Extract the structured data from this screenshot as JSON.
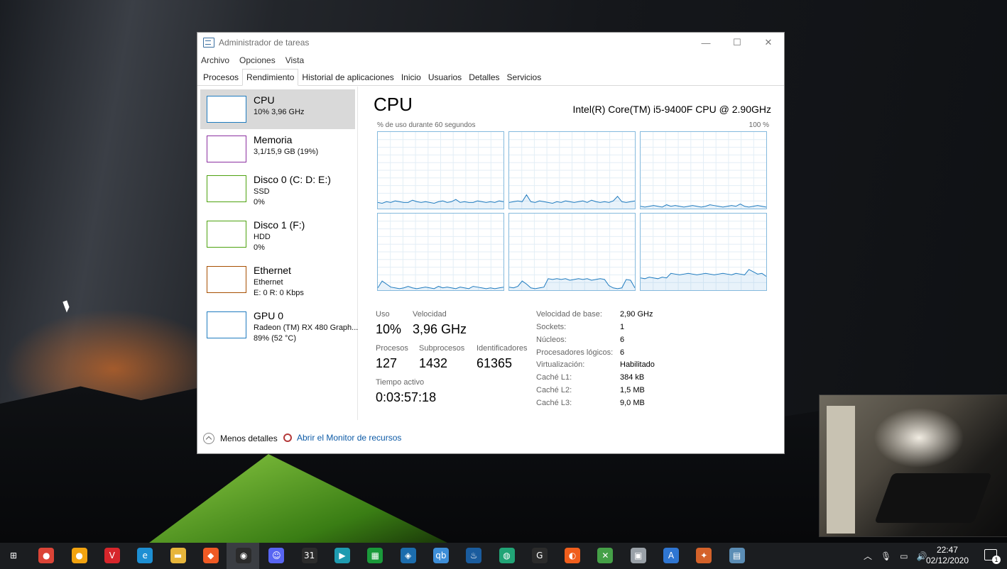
{
  "window": {
    "title": "Administrador de tareas",
    "controls": {
      "minimize": "—",
      "maximize": "☐",
      "close": "✕"
    }
  },
  "menu": [
    "Archivo",
    "Opciones",
    "Vista"
  ],
  "tabs": [
    "Procesos",
    "Rendimiento",
    "Historial de aplicaciones",
    "Inicio",
    "Usuarios",
    "Detalles",
    "Servicios"
  ],
  "active_tab": "Rendimiento",
  "sidebar": [
    {
      "name": "CPU",
      "line1": "10% 3,96 GHz",
      "line2": "",
      "color": "#1f7bbf",
      "selected": true
    },
    {
      "name": "Memoria",
      "line1": "3,1/15,9 GB (19%)",
      "line2": "",
      "color": "#8b2fa0",
      "selected": false
    },
    {
      "name": "Disco 0 (C: D: E:)",
      "line1": "SSD",
      "line2": "0%",
      "color": "#4da20f",
      "selected": false
    },
    {
      "name": "Disco 1 (F:)",
      "line1": "HDD",
      "line2": "0%",
      "color": "#4da20f",
      "selected": false
    },
    {
      "name": "Ethernet",
      "line1": "Ethernet",
      "line2": "E: 0 R: 0 Kbps",
      "color": "#a74f01",
      "selected": false
    },
    {
      "name": "GPU 0",
      "line1": "Radeon (TM) RX 480 Graph...",
      "line2": "89% (52 °C)",
      "color": "#1f7bbf",
      "selected": false
    }
  ],
  "main": {
    "title": "CPU",
    "model": "Intel(R) Core(TM) i5-9400F CPU @ 2.90GHz",
    "usage_label": "% de uso durante 60 segundos",
    "max_label": "100 %",
    "stats": {
      "uso_label": "Uso",
      "uso": "10%",
      "velocidad_label": "Velocidad",
      "velocidad": "3,96 GHz",
      "procesos_label": "Procesos",
      "procesos": "127",
      "subprocesos_label": "Subprocesos",
      "subprocesos": "1432",
      "identificadores_label": "Identificadores",
      "identificadores": "61365",
      "tiempo_label": "Tiempo activo",
      "tiempo": "0:03:57:18"
    },
    "details": [
      {
        "k": "Velocidad de base:",
        "v": "2,90 GHz"
      },
      {
        "k": "Sockets:",
        "v": "1"
      },
      {
        "k": "Núcleos:",
        "v": "6"
      },
      {
        "k": "Procesadores lógicos:",
        "v": "6"
      },
      {
        "k": "Virtualización:",
        "v": "Habilitado"
      },
      {
        "k": "Caché L1:",
        "v": "384 kB"
      },
      {
        "k": "Caché L2:",
        "v": "1,5 MB"
      },
      {
        "k": "Caché L3:",
        "v": "9,0 MB"
      }
    ],
    "core_graphs": [
      [
        8,
        7,
        9,
        8,
        10,
        9,
        8,
        8,
        11,
        9,
        8,
        9,
        8,
        7,
        9,
        10,
        8,
        9,
        12,
        8,
        9,
        8,
        8,
        10,
        9,
        8,
        9,
        8,
        10,
        9
      ],
      [
        8,
        9,
        10,
        9,
        18,
        9,
        8,
        10,
        9,
        8,
        7,
        9,
        8,
        10,
        9,
        8,
        9,
        10,
        8,
        11,
        9,
        8,
        9,
        8,
        10,
        16,
        9,
        8,
        9,
        10
      ],
      [
        3,
        2,
        3,
        4,
        3,
        2,
        5,
        3,
        4,
        3,
        2,
        3,
        4,
        3,
        2,
        3,
        5,
        4,
        3,
        2,
        3,
        4,
        3,
        6,
        3,
        2,
        3,
        4,
        3,
        2
      ],
      [
        3,
        12,
        8,
        4,
        3,
        2,
        3,
        5,
        3,
        2,
        3,
        4,
        3,
        2,
        5,
        3,
        4,
        3,
        2,
        4,
        3,
        2,
        5,
        4,
        3,
        2,
        3,
        2,
        3,
        4
      ],
      [
        4,
        3,
        5,
        12,
        8,
        3,
        2,
        3,
        4,
        15,
        14,
        15,
        14,
        15,
        13,
        14,
        15,
        14,
        15,
        13,
        14,
        15,
        14,
        6,
        3,
        2,
        3,
        14,
        13,
        3
      ],
      [
        16,
        15,
        17,
        16,
        15,
        17,
        16,
        22,
        21,
        20,
        21,
        22,
        21,
        20,
        21,
        22,
        21,
        20,
        21,
        22,
        21,
        20,
        22,
        21,
        20,
        27,
        24,
        21,
        22,
        18
      ]
    ],
    "core_graph_max": 100
  },
  "footer": {
    "less": "Menos detalles",
    "monitor": "Abrir el Monitor de recursos"
  },
  "taskbar": {
    "time": "22:47",
    "date": "02/12/2020",
    "notifications": "1",
    "apps": [
      {
        "name": "start-icon",
        "glyph": "⊞",
        "color": "#1b1d20"
      },
      {
        "name": "chrome-icon",
        "glyph": "●",
        "color": "#db4437"
      },
      {
        "name": "chrome-canary-icon",
        "glyph": "●",
        "color": "#f2a30f"
      },
      {
        "name": "vivaldi-icon",
        "glyph": "V",
        "color": "#d7262b"
      },
      {
        "name": "edge-icon",
        "glyph": "e",
        "color": "#1d8fd3"
      },
      {
        "name": "file-explorer-icon",
        "glyph": "▬",
        "color": "#e7b53b"
      },
      {
        "name": "brave-icon",
        "glyph": "◆",
        "color": "#ef5a24"
      },
      {
        "name": "obs-icon",
        "glyph": "◉",
        "color": "#2b2b2b"
      },
      {
        "name": "discord-icon",
        "glyph": "☺",
        "color": "#5865f2"
      },
      {
        "name": "calendar-icon",
        "glyph": "31",
        "color": "#2c2c2c"
      },
      {
        "name": "media-icon",
        "glyph": "▶",
        "color": "#1f9bb0"
      },
      {
        "name": "film-icon",
        "glyph": "▦",
        "color": "#1a9a3a"
      },
      {
        "name": "vs-icon",
        "glyph": "◈",
        "color": "#1c6dad"
      },
      {
        "name": "qbittorrent-icon",
        "glyph": "qb",
        "color": "#3d8ed8"
      },
      {
        "name": "steam-icon",
        "glyph": "♨",
        "color": "#1a5c9e"
      },
      {
        "name": "gamepad-icon",
        "glyph": "◍",
        "color": "#21a476"
      },
      {
        "name": "app-g-icon",
        "glyph": "G",
        "color": "#2b2b2b"
      },
      {
        "name": "firefox-icon",
        "glyph": "◐",
        "color": "#f05e1c"
      },
      {
        "name": "xbox-icon",
        "glyph": "✕",
        "color": "#45a047"
      },
      {
        "name": "recycle-icon",
        "glyph": "▣",
        "color": "#9aa1a8"
      },
      {
        "name": "translator-icon",
        "glyph": "A",
        "color": "#2f76d2"
      },
      {
        "name": "game-icon",
        "glyph": "✦",
        "color": "#d4622a"
      },
      {
        "name": "task-manager-icon",
        "glyph": "▤",
        "color": "#5b8db5"
      }
    ]
  }
}
